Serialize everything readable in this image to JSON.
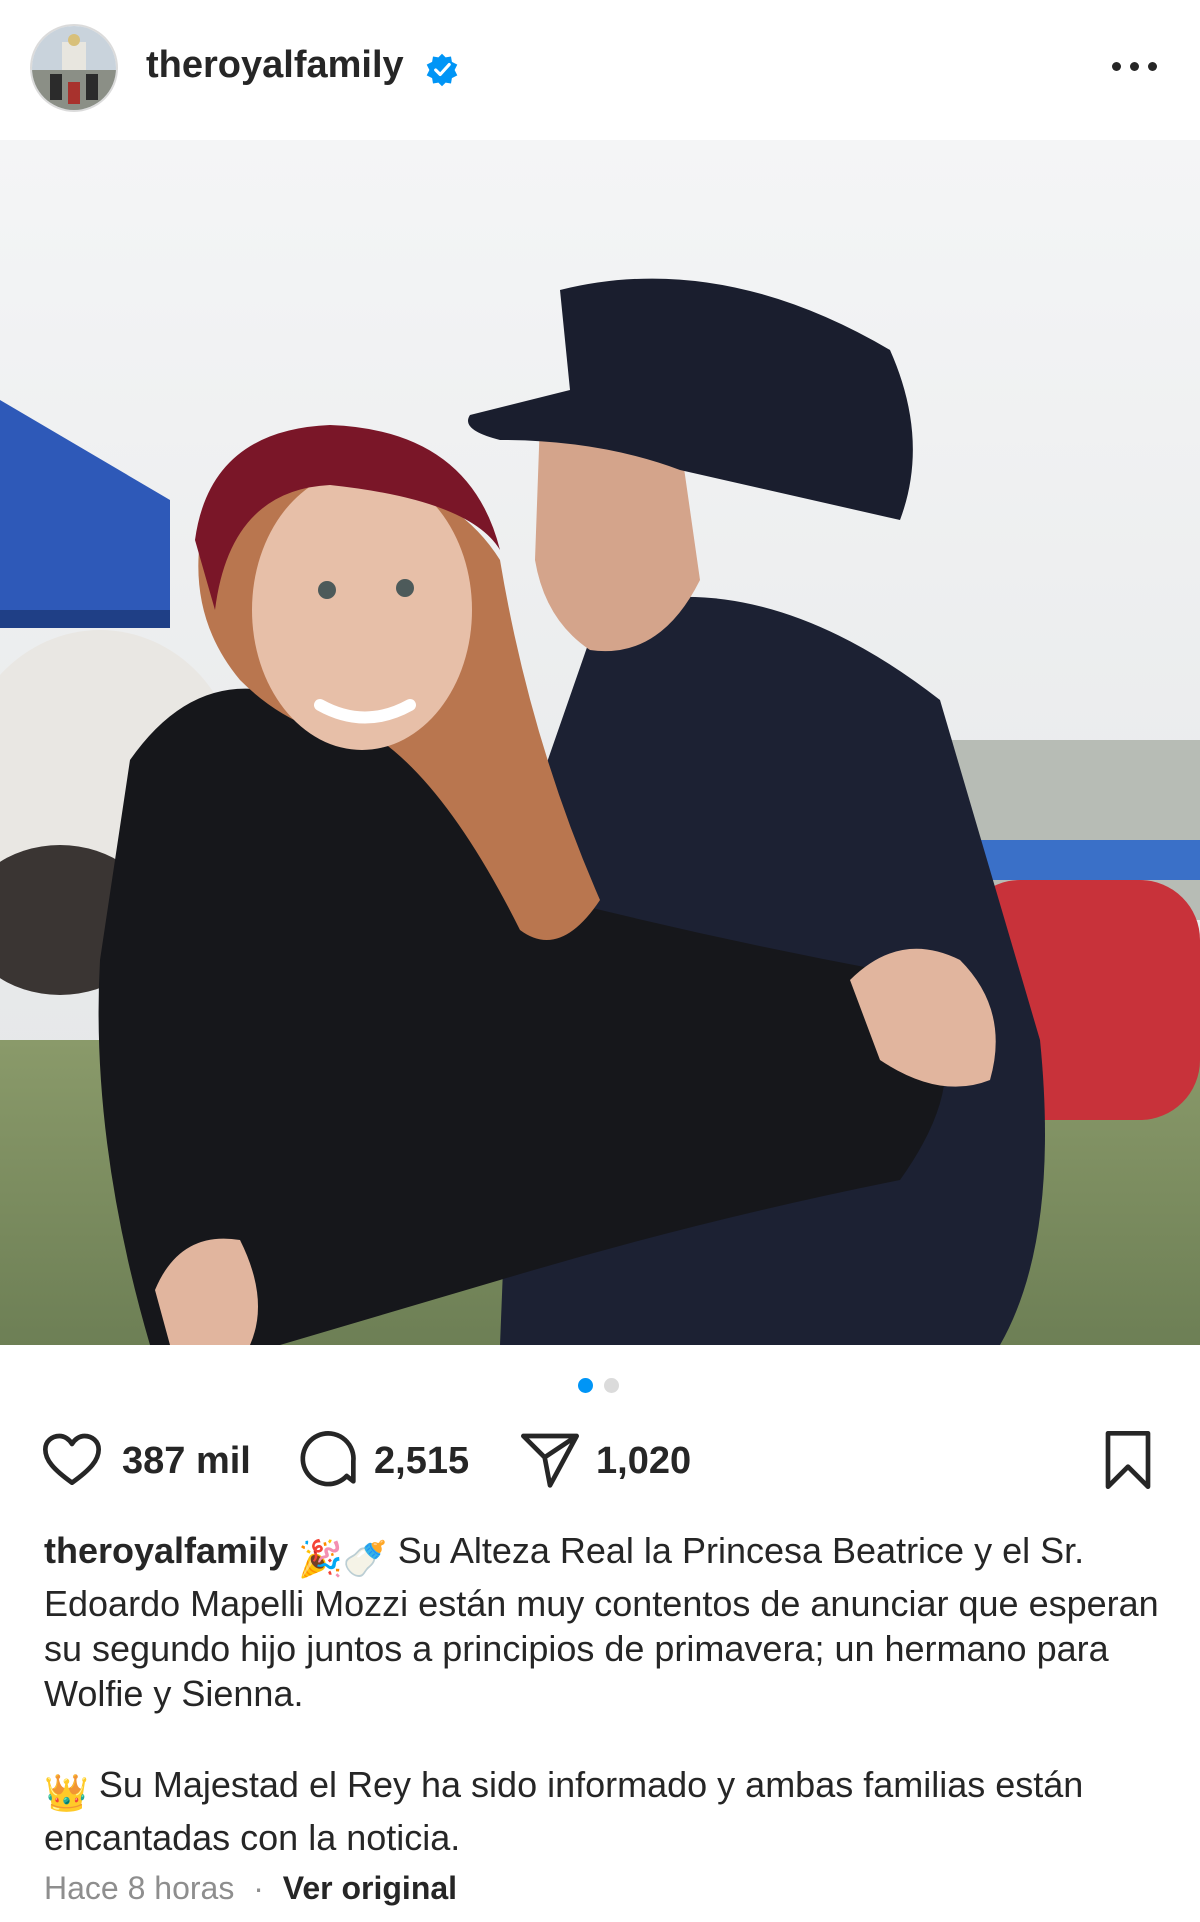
{
  "post": {
    "username": "theroyalfamily",
    "verified_icon": "verified-badge-icon",
    "more_icon": "more-options-icon",
    "carousel": {
      "total": 2,
      "active_index": 0,
      "active_color": "#0095f6",
      "inactive_color": "#dbdbdb"
    },
    "likes": "387 mil",
    "comments": "2,515",
    "shares": "1,020",
    "caption": {
      "username": "theroyalfamily",
      "emojis_1": "🎉🍼",
      "text_1": "Su Alteza Real la Princesa Beatrice y el Sr. Edoardo Mapelli Mozzi están muy contentos de anunciar que esperan su segundo hijo juntos a principios de primavera; un hermano para Wolfie y Sienna.",
      "emoji_2": "👑",
      "text_2": "Su Majestad el Rey ha sido informado y ambas familias están encantadas con la noticia."
    },
    "time": "Hace 8 horas",
    "separator": "·",
    "see_original": "Ver original"
  }
}
